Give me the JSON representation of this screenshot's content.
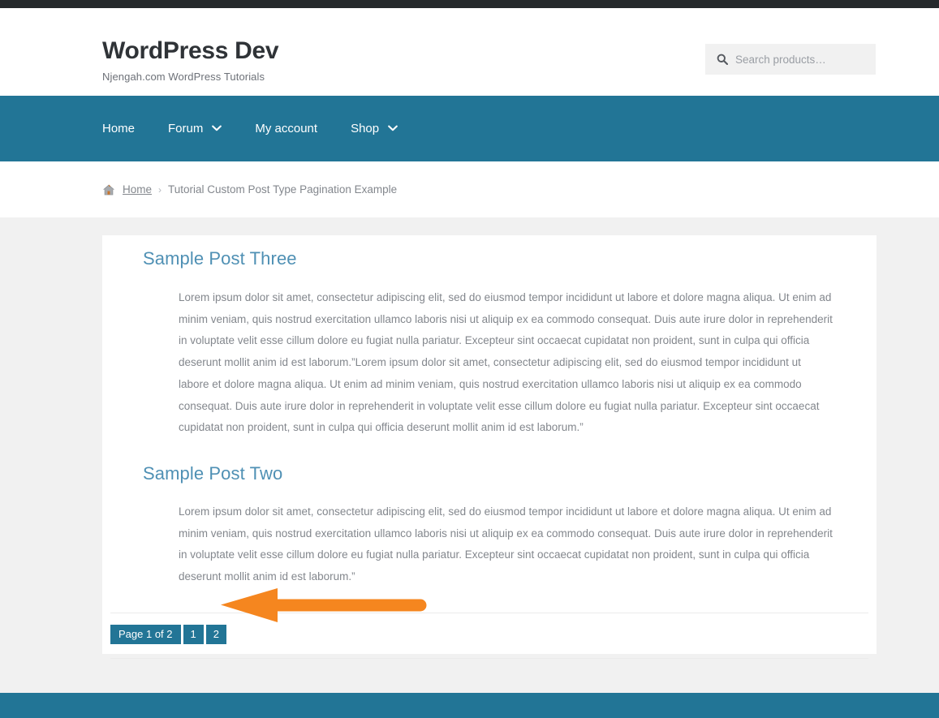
{
  "colors": {
    "brand_teal": "#227596",
    "dark_bar": "#25292c",
    "page_bg": "#f1f1f1",
    "heading_blue": "#4f90b4",
    "body_text": "#83878d",
    "annotation_orange": "#f5861f"
  },
  "header": {
    "site_title": "WordPress Dev",
    "tagline": "Njengah.com WordPress Tutorials",
    "search": {
      "placeholder": "Search products…",
      "value": "",
      "icon": "search-icon"
    }
  },
  "nav": {
    "items": [
      {
        "label": "Home",
        "has_dropdown": false
      },
      {
        "label": "Forum",
        "has_dropdown": true
      },
      {
        "label": "My account",
        "has_dropdown": false
      },
      {
        "label": "Shop",
        "has_dropdown": true
      }
    ]
  },
  "breadcrumb": {
    "home_icon": "home-icon",
    "home_label": "Home",
    "separator": "›",
    "current": "Tutorial Custom Post Type Pagination Example"
  },
  "posts": [
    {
      "title": "Sample Post Three",
      "body": "Lorem ipsum dolor sit amet, consectetur adipiscing elit, sed do eiusmod tempor incididunt ut labore et dolore magna aliqua. Ut enim ad minim veniam, quis nostrud exercitation ullamco laboris nisi ut aliquip ex ea commodo consequat. Duis aute irure dolor in reprehenderit in voluptate velit esse cillum dolore eu fugiat nulla pariatur. Excepteur sint occaecat cupidatat non proident, sunt in culpa qui officia deserunt mollit anim id est laborum.”Lorem ipsum dolor sit amet, consectetur adipiscing elit, sed do eiusmod tempor incididunt ut labore et dolore magna aliqua. Ut enim ad minim veniam, quis nostrud exercitation ullamco laboris nisi ut aliquip ex ea commodo consequat. Duis aute irure dolor in reprehenderit in voluptate velit esse cillum dolore eu fugiat nulla pariatur. Excepteur sint occaecat cupidatat non proident, sunt in culpa qui officia deserunt mollit anim id est laborum.”"
    },
    {
      "title": "Sample Post Two",
      "body": "Lorem ipsum dolor sit amet, consectetur adipiscing elit, sed do eiusmod tempor incididunt ut labore et dolore magna aliqua. Ut enim ad minim veniam, quis nostrud exercitation ullamco laboris nisi ut aliquip ex ea commodo consequat. Duis aute irure dolor in reprehenderit in voluptate velit esse cillum dolore eu fugiat nulla pariatur. Excepteur sint occaecat cupidatat non proident, sunt in culpa qui officia deserunt mollit anim id est laborum.”"
    }
  ],
  "pagination": {
    "page_info": "Page 1 of 2",
    "pages": [
      {
        "label": "1",
        "current": true
      },
      {
        "label": "2",
        "current": false
      }
    ]
  },
  "annotation": {
    "type": "arrow-left",
    "color": "#f5861f",
    "points_at": "pagination"
  }
}
